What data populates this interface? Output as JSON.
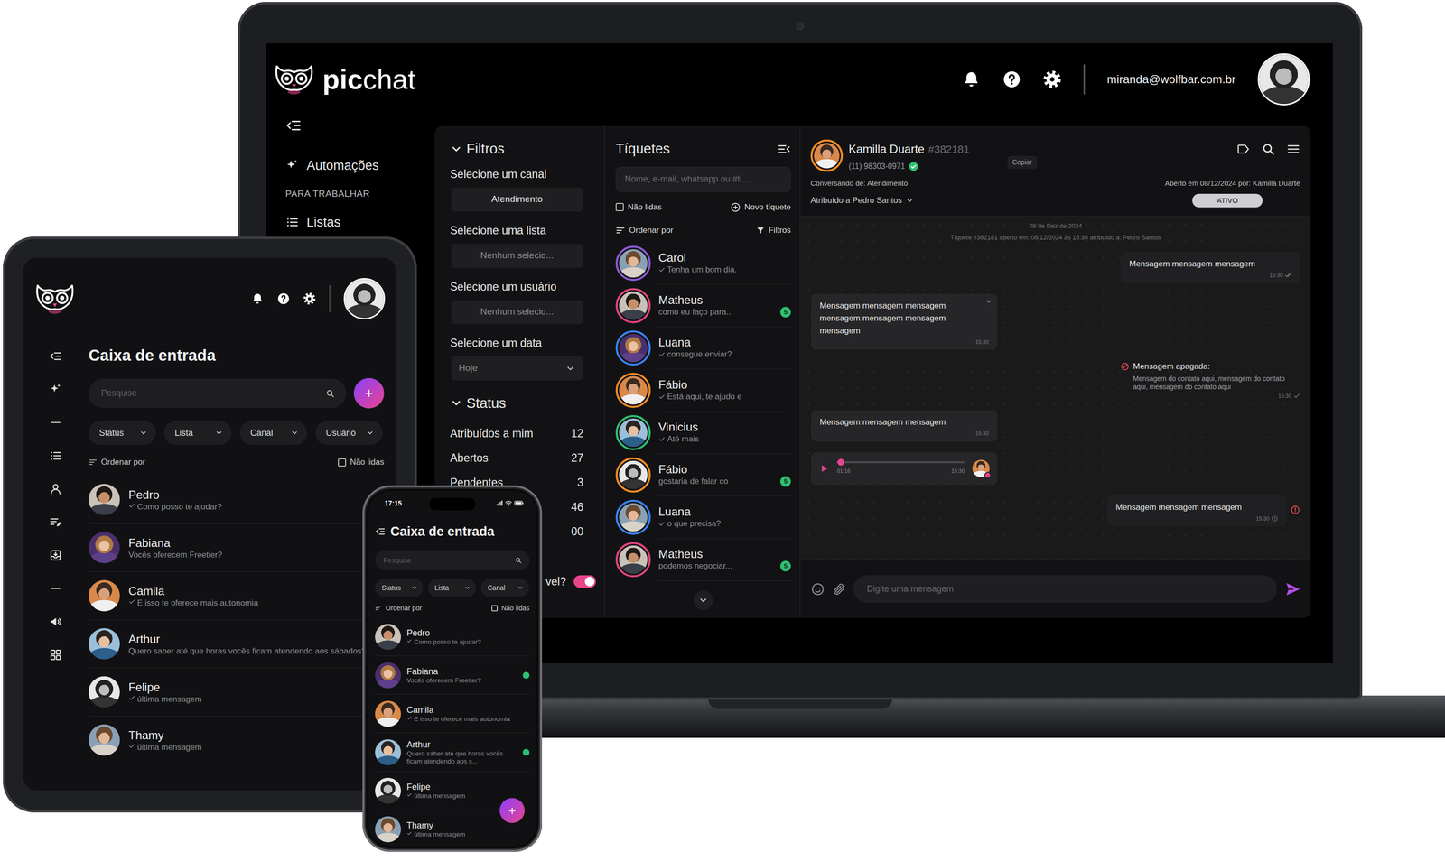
{
  "laptop": {
    "logo": {
      "bold": "pic",
      "light": "chat"
    },
    "user_email": "miranda@wolfbar.com.br",
    "sidebar": {
      "items": [
        {
          "label": "Automações",
          "kind": "link"
        },
        {
          "label": "PARA TRABALHAR",
          "kind": "section"
        },
        {
          "label": "Listas",
          "kind": "link"
        }
      ]
    },
    "filters": {
      "title": "Filtros",
      "expanded": true,
      "fields": [
        {
          "label": "Selecione um canal",
          "value": "Atendimento",
          "muted": false,
          "kind": "select"
        },
        {
          "label": "Selecione uma lista",
          "value": "Nenhum selecio...",
          "muted": true,
          "kind": "select"
        },
        {
          "label": "Selecione um usuário",
          "value": "Nenhum selecio...",
          "muted": true,
          "kind": "select"
        },
        {
          "label": "Selecione um data",
          "value": "Hoje",
          "muted": true,
          "kind": "dropdown"
        }
      ]
    },
    "status": {
      "title": "Status",
      "expanded": true,
      "rows": [
        {
          "label": "Atribuídos a mim",
          "count": "12"
        },
        {
          "label": "Abertos",
          "count": "27"
        },
        {
          "label": "Pendentes",
          "count": "3"
        },
        {
          "count": "46"
        },
        {
          "count": "00"
        }
      ],
      "toggle": {
        "label": "vel?",
        "on": true
      }
    },
    "tickets": {
      "title": "Tíquetes",
      "search": {
        "placeholder": "Nome, e-mail, whatsapp ou #ti..."
      },
      "unread_filter": {
        "label": "Não lidas",
        "checked": false
      },
      "new_ticket": "Novo tíquete",
      "sort_label": "Ordenar por",
      "filter_label": "Filtros",
      "items": [
        {
          "name": "Carol",
          "preview": "Tenha um bom dia.",
          "read": true,
          "color": "#8e5bd6"
        },
        {
          "name": "Matheus",
          "preview": "como eu faço para...",
          "read": false,
          "unread_count": "5",
          "color": "#e0457b"
        },
        {
          "name": "Luana",
          "preview": "consegue enviar?",
          "read": true,
          "color": "#3b82f6"
        },
        {
          "name": "Fábio",
          "preview": "Está aqui, te ajudo e",
          "read": true,
          "color": "#f08a24"
        },
        {
          "name": "Vinicius",
          "preview": "Até mais",
          "read": true,
          "color": "#2fbf71"
        },
        {
          "name": "Fábio",
          "preview": "gostaria de falar co",
          "read": false,
          "unread_count": "5",
          "color": "#f08a24"
        },
        {
          "name": "Luana",
          "preview": "o que precisa?",
          "read": true,
          "color": "#3b82f6"
        },
        {
          "name": "Matheus",
          "preview": "podemos negociar...",
          "read": false,
          "unread_count": "5",
          "color": "#e0457b"
        }
      ]
    },
    "chat": {
      "contact": {
        "name": "Kamilla Duarte",
        "ticket": "#382181",
        "phone": "(11) 98303-0971",
        "verified": true
      },
      "copy_label": "Copiar",
      "channel_info": "Conversando de: Atendimento",
      "opened_info": "Aberto em 08/12/2024 por: Kamilla Duarte",
      "assigned": "Atribuído a Pedro Santos",
      "status_badge": "ATIVO",
      "date_divider": "08 de Dez de 2024",
      "system_note": "Tíquete #382181 aberto em: 08/12/2024 às 15:30 atribuído à: Pedro Santos",
      "messages": [
        {
          "kind": "text",
          "outgoing": true,
          "text": "Mensagem mensagem mensagem",
          "time": "15:30",
          "delivery": "read"
        },
        {
          "kind": "text",
          "outgoing": false,
          "text": "Mensagem mensagem mensagem mensagem mensagem mensagem mensagem",
          "time": "15:30",
          "hovered": true
        },
        {
          "kind": "deleted",
          "outgoing": true,
          "title": "Mensagem apagada:",
          "text": "Mensagem do contato aqui, mensagem do contato aqui, mensagem do contato aqui",
          "time": "15:30",
          "delivery": "sent"
        },
        {
          "kind": "text",
          "outgoing": false,
          "text": "Mensagem mensagem mensagem",
          "time": "15:30"
        },
        {
          "kind": "audio",
          "outgoing": false,
          "position": "01:16",
          "time": "15:30",
          "level": 0.03
        },
        {
          "kind": "text",
          "outgoing": true,
          "text": "Mensagem mensagem mensagem",
          "time": "15:30",
          "delivery": "pending",
          "failed": true
        }
      ],
      "composer": {
        "placeholder": "Digite uma mensagem"
      }
    }
  },
  "tablet": {
    "title": "Caixa de entrada",
    "search": {
      "placeholder": "Pesquise"
    },
    "add_label": "+",
    "filters": [
      {
        "label": "Status"
      },
      {
        "label": "Lista"
      },
      {
        "label": "Canal"
      },
      {
        "label": "Usuário"
      }
    ],
    "sort_label": "Ordenar por",
    "unread_filter": {
      "label": "Não lidas",
      "checked": false
    },
    "conversations": [
      {
        "name": "Pedro",
        "preview": "Como posso te ajudar?",
        "read": true
      },
      {
        "name": "Fabiana",
        "preview": "Vocês oferecem Freetier?",
        "read": false
      },
      {
        "name": "Camila",
        "preview": "E isso te oferece mais autonomia",
        "read": true
      },
      {
        "name": "Arthur",
        "preview": "Quero saber até que horas vocês ficam atendendo aos sábados?",
        "read": false
      },
      {
        "name": "Felipe",
        "preview": "última mensagem",
        "read": true
      },
      {
        "name": "Thamy",
        "preview": "última mensagem",
        "read": true
      }
    ]
  },
  "phone": {
    "time": "17:15",
    "title": "Caixa de entrada",
    "search": {
      "placeholder": "Pesquise"
    },
    "filters": [
      {
        "label": "Status"
      },
      {
        "label": "Lista"
      },
      {
        "label": "Canal"
      }
    ],
    "sort_label": "Ordenar por",
    "unread_filter": {
      "label": "Não lidas",
      "checked": false
    },
    "conversations": [
      {
        "name": "Pedro",
        "preview": "Como posso te ajudar?",
        "read": true,
        "unread": false
      },
      {
        "name": "Fabiana",
        "preview": "Vocês oferecem Freetier?",
        "read": false,
        "unread": true
      },
      {
        "name": "Camila",
        "preview": "E isso te oferece mais autonomia",
        "read": true,
        "unread": false
      },
      {
        "name": "Arthur",
        "preview": "Quero saber até que horas vocês ficam atendendo aos s...",
        "read": false,
        "unread": true
      },
      {
        "name": "Felipe",
        "preview": "última mensagem",
        "read": true,
        "unread": false
      },
      {
        "name": "Thamy",
        "preview": "última mensagem",
        "read": true,
        "unread": false
      }
    ],
    "add_label": "+"
  }
}
